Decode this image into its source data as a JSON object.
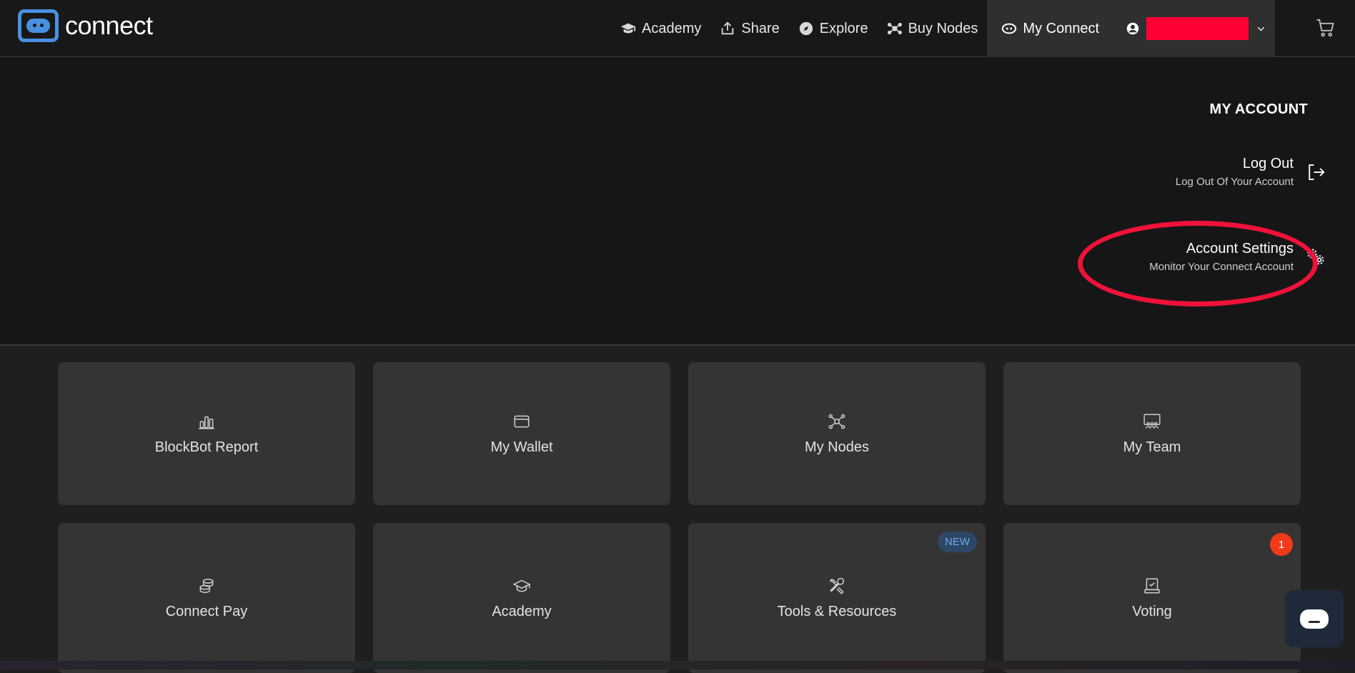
{
  "brand": {
    "name": "connect",
    "accent": "#4a90e2"
  },
  "nav": {
    "items": [
      {
        "label": "Academy",
        "icon": "graduation-cap-icon"
      },
      {
        "label": "Share",
        "icon": "share-upload-icon"
      },
      {
        "label": "Explore",
        "icon": "compass-icon"
      },
      {
        "label": "Buy Nodes",
        "icon": "nodes-icon"
      },
      {
        "label": "My Connect",
        "icon": "eye-icon"
      }
    ],
    "user_icon": "user-circle-icon",
    "cart_icon": "cart-icon"
  },
  "account": {
    "title": "MY ACCOUNT",
    "logout": {
      "label": "Log Out",
      "sub": "Log Out Of Your Account"
    },
    "settings": {
      "label": "Account Settings",
      "sub": "Monitor Your Connect Account"
    }
  },
  "tiles": [
    {
      "label": "BlockBot Report",
      "icon": "bar-chart-icon"
    },
    {
      "label": "My Wallet",
      "icon": "wallet-icon"
    },
    {
      "label": "My Nodes",
      "icon": "nodes-icon"
    },
    {
      "label": "My Team",
      "icon": "team-icon"
    },
    {
      "label": "Connect Pay",
      "icon": "coins-icon"
    },
    {
      "label": "Academy",
      "icon": "graduation-cap-icon"
    },
    {
      "label": "Tools & Resources",
      "icon": "tools-icon",
      "badge": "NEW"
    },
    {
      "label": "Voting",
      "icon": "ballot-icon",
      "count": "1"
    }
  ],
  "colors": {
    "highlight": "#f0123a",
    "badge_new_bg": "#2e4766",
    "count_badge": "#f13a1a"
  }
}
